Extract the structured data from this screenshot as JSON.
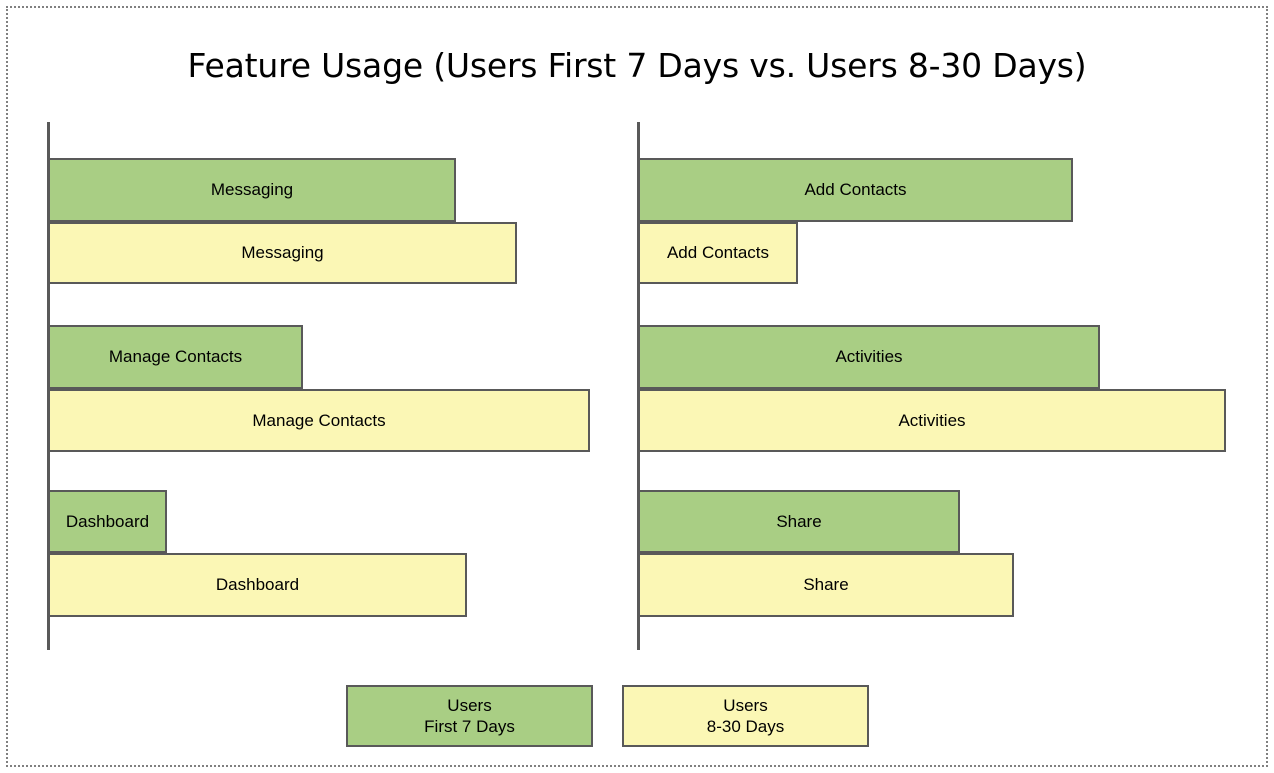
{
  "title": "Feature Usage (Users First 7 Days vs. Users 8-30 Days)",
  "colors": {
    "series_first_7_days": "#A9CE84",
    "series_8_30_days": "#FBF7B5",
    "bar_border": "#595959",
    "axis": "#595959",
    "slide_border": "#808080",
    "background": "#FFFFFF",
    "text": "#000000"
  },
  "legend": {
    "items": [
      {
        "name": "legend-first-7-days",
        "line1": "Users",
        "line2": "First 7 Days",
        "color": "#A9CE84"
      },
      {
        "name": "legend-8-30-days",
        "line1": "Users",
        "line2": "8-30 Days",
        "color": "#FBF7B5"
      }
    ]
  },
  "chart_data": {
    "type": "bar",
    "orientation": "horizontal",
    "title": "Feature Usage (Users First 7 Days vs. Users 8-30 Days)",
    "xlabel": "",
    "ylabel": "",
    "grid": false,
    "legend_position": "bottom",
    "panels": [
      {
        "name": "left-panel",
        "categories": [
          "Messaging",
          "Manage Contacts",
          "Dashboard"
        ],
        "series": [
          {
            "name": "Users First 7 Days",
            "color": "#A9CE84",
            "values": [
              408,
              255,
              119
            ]
          },
          {
            "name": "Users 8-30 Days",
            "color": "#FBF7B5",
            "values": [
              469,
              542,
              419
            ]
          }
        ],
        "bars": [
          {
            "category": "Messaging",
            "series": "Users First 7 Days",
            "length": 408
          },
          {
            "category": "Messaging",
            "series": "Users 8-30 Days",
            "length": 469
          },
          {
            "category": "Manage Contacts",
            "series": "Users First 7 Days",
            "length": 255
          },
          {
            "category": "Manage Contacts",
            "series": "Users 8-30 Days",
            "length": 542
          },
          {
            "category": "Dashboard",
            "series": "Users First 7 Days",
            "length": 119
          },
          {
            "category": "Dashboard",
            "series": "Users 8-30 Days",
            "length": 419
          }
        ]
      },
      {
        "name": "right-panel",
        "categories": [
          "Add Contacts",
          "Activities",
          "Share"
        ],
        "series": [
          {
            "name": "Users First 7 Days",
            "color": "#A9CE84",
            "values": [
              435,
              462,
              322
            ]
          },
          {
            "name": "Users 8-30 Days",
            "color": "#FBF7B5",
            "values": [
              160,
              588,
              376
            ]
          }
        ],
        "bars": [
          {
            "category": "Add Contacts",
            "series": "Users First 7 Days",
            "length": 435
          },
          {
            "category": "Add Contacts",
            "series": "Users 8-30 Days",
            "length": 160
          },
          {
            "category": "Activities",
            "series": "Users First 7 Days",
            "length": 462
          },
          {
            "category": "Activities",
            "series": "Users 8-30 Days",
            "length": 588
          },
          {
            "category": "Share",
            "series": "Users First 7 Days",
            "length": 322
          },
          {
            "category": "Share",
            "series": "Users 8-30 Days",
            "length": 376
          }
        ]
      }
    ]
  }
}
